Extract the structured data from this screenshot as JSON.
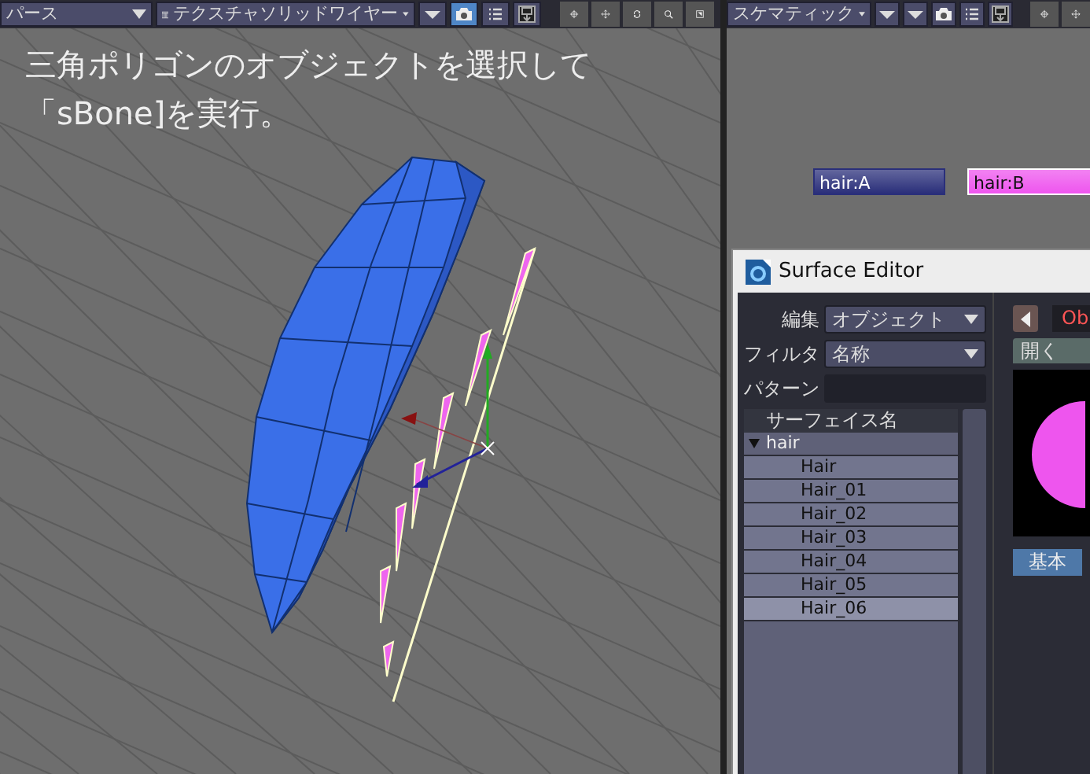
{
  "left_viewport": {
    "view_menu": "パース",
    "render_menu": "テクスチャソリッドワイヤー",
    "tool_buttons": [
      {
        "kind": "arrow",
        "selected": false
      },
      {
        "kind": "camera",
        "selected": true
      },
      {
        "kind": "list",
        "selected": false
      },
      {
        "kind": "save",
        "selected": false
      }
    ],
    "caption_lines": [
      "三角ポリゴンのオブジェクトを選択して",
      "「sBone]を実行。"
    ]
  },
  "right_viewport": {
    "view_menu": "スケマティック",
    "tool_buttons": [
      {
        "kind": "arrow",
        "selected": false
      },
      {
        "kind": "arrow",
        "selected": false
      },
      {
        "kind": "camera",
        "selected": false
      },
      {
        "kind": "list",
        "selected": false
      },
      {
        "kind": "save",
        "selected": false
      }
    ],
    "nodes": [
      {
        "label": "hair:A",
        "color": "#2a2f7a",
        "selected": false
      },
      {
        "label": "hair:B",
        "color": "#ee55ee",
        "selected": true
      }
    ]
  },
  "surface_editor": {
    "title": "Surface Editor",
    "edit_label": "編集",
    "edit_value": "オブジェクト",
    "filter_label": "フィルタ",
    "filter_value": "名称",
    "pattern_label": "パターン",
    "list_header": "サーフェイス名",
    "tree": [
      {
        "label": "hair",
        "expanded": true,
        "selected": false,
        "children": [
          {
            "label": "Hair",
            "selected": false
          },
          {
            "label": "Hair_01",
            "selected": false
          },
          {
            "label": "Hair_02",
            "selected": false
          },
          {
            "label": "Hair_03",
            "selected": false
          },
          {
            "label": "Hair_04",
            "selected": false
          },
          {
            "label": "Hair_05",
            "selected": false
          },
          {
            "label": "Hair_06",
            "selected": true
          }
        ]
      }
    ],
    "object_field": "Ob",
    "open_button": "開く",
    "tabs": [
      {
        "label": "基本",
        "selected": true
      }
    ]
  }
}
